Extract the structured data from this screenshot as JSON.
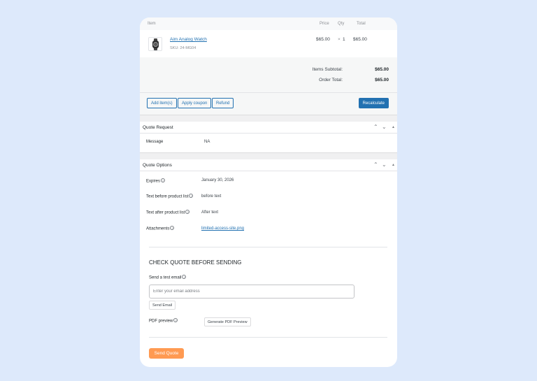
{
  "order_items": {
    "headers": {
      "item": "Item",
      "price": "Price",
      "qty": "Qty",
      "total": "Total"
    },
    "rows": [
      {
        "name": "Aim Analog Watch",
        "sku": "SKU: 24-MG04",
        "price": "$65.00",
        "qty_x": "×",
        "qty": "1",
        "total": "$65.00"
      }
    ],
    "items_subtotal_label": "Items Subtotal:",
    "items_subtotal_value": "$65.00",
    "order_total_label": "Order Total:",
    "order_total_value": "$65.00",
    "buttons": {
      "add_items": "Add item(s)",
      "apply_coupon": "Apply coupon",
      "refund": "Refund",
      "recalculate": "Recalculate"
    }
  },
  "quote_request": {
    "title": "Quote Request",
    "message_label": "Message",
    "message_value": "NA"
  },
  "quote_options": {
    "title": "Quote Options",
    "expires_label": "Expires",
    "expires_value": "January 30, 2026",
    "text_before_label": "Text before product list",
    "text_before_value": "before text",
    "text_after_label": "Text after product list",
    "text_after_value": "After text",
    "attachments_label": "Attachments",
    "attachments_value": "limited-access-site.png"
  },
  "check_quote": {
    "title": "CHECK QUOTE BEFORE SENDING",
    "test_email_label": "Send a test email",
    "email_placeholder": "Enter your email address",
    "send_email_button": "Send Email",
    "pdf_preview_label": "PDF preview",
    "generate_pdf_button": "Generate PDF Preview",
    "send_quote_button": "Send Quote"
  },
  "icons": {
    "chevron_up": "chevron-up-icon",
    "chevron_down": "chevron-down-icon",
    "triangle_up": "toggle-panel-icon",
    "help": "help-icon"
  },
  "colors": {
    "background": "#dde9fb",
    "accent": "#2271b1",
    "send_quote": "#ff9a52"
  }
}
